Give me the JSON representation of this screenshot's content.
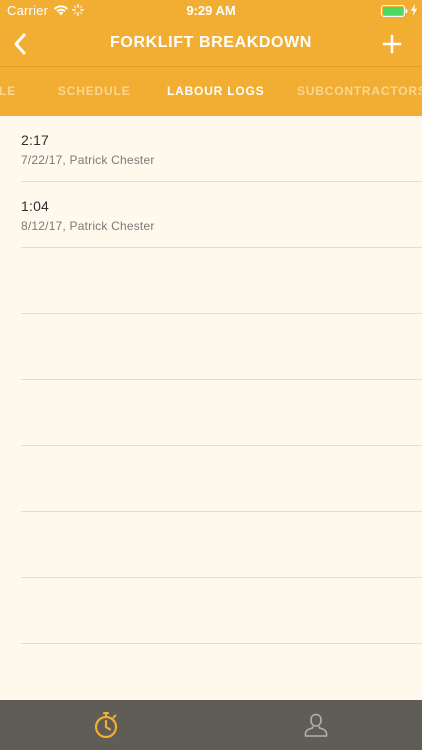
{
  "status_bar": {
    "carrier": "Carrier",
    "time": "9:29 AM",
    "battery_color": "#4CD964"
  },
  "nav": {
    "title": "FORKLIFT BREAKDOWN",
    "back_icon": "chevron-left-icon",
    "add_icon": "plus-icon"
  },
  "tabs": [
    {
      "label": "PROFILE",
      "visible_text": "ILE",
      "active": false
    },
    {
      "label": "SCHEDULE",
      "visible_text": "SCHEDULE",
      "active": false
    },
    {
      "label": "LABOUR LOGS",
      "visible_text": "LABOUR LOGS",
      "active": true
    },
    {
      "label": "SUBCONTRACTORS",
      "visible_text": "SUBCONTRACTORS",
      "active": false
    }
  ],
  "logs": [
    {
      "duration": "2:17",
      "meta": "7/22/17, Patrick Chester"
    },
    {
      "duration": "1:04",
      "meta": "8/12/17, Patrick Chester"
    }
  ],
  "tab_bar": {
    "items": [
      {
        "icon": "stopwatch-icon",
        "active": true
      },
      {
        "icon": "person-icon",
        "active": false
      }
    ]
  },
  "colors": {
    "accent": "#F2AE33",
    "background": "#FEF9EC",
    "tab_bar": "#5F5D56",
    "tab_inactive": "#FBD68F"
  }
}
